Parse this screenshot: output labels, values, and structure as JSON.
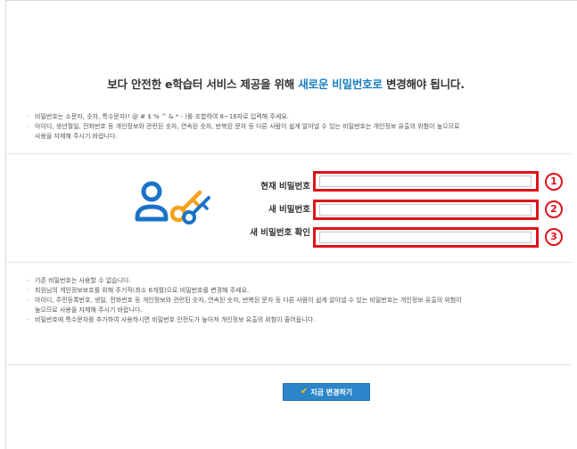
{
  "headline": {
    "prefix": "보다 안전한 e학습터 서비스 제공을 위해 ",
    "highlight": "새로운 비밀번호로",
    "suffix": " 변경해야 됩니다."
  },
  "rules": [
    {
      "line1": "비밀번호는 소문자, 숫자, 특수문자(! @ # $ % ^ & * - )를 조합하여 8~16자로 입력해 주세요.",
      "line2": ""
    },
    {
      "line1": "아이디, 생년월일, 전화번호 등 개인정보와 관련된 숫자, 연속된 숫자, 반복된 문자 등 다른 사람이 쉽게 알아낼 수 있는 비밀번호는 개인정보 유출의 위험이 높으므로",
      "line2": "사용을 자제해 주시기 바랍니다."
    }
  ],
  "form": {
    "current_password_label": "현재 비밀번호",
    "new_password_label": "새 비밀번호",
    "confirm_password_label": "새 비밀번호 확인",
    "current_password_value": "",
    "new_password_value": "",
    "confirm_password_value": ""
  },
  "annotations": {
    "marker_1": "1",
    "marker_2": "2",
    "marker_3": "3",
    "color": "#e0121a"
  },
  "notes": [
    {
      "line1": "기존 비밀번호는 사용할 수 없습니다.",
      "line2": ""
    },
    {
      "line1": "회원님의 개인정보보호를 위해 주기적(최소 6개월)으로 비밀번호를 변경해 주세요.",
      "line2": ""
    },
    {
      "line1": "아이디, 주민등록번호, 생일, 전화번호 등 개인정보와 관련된 숫자, 연속된 숫자, 반복된 문자 등 다른 사람이 쉽게 알아낼 수 있는 비밀번호는 개인정보 유출의 위험이",
      "line2": "높으므로 사용을 자제해 주시기 바랍니다."
    },
    {
      "line1": "비밀번호에 특수문자를 추가하여 사용하시면 비밀번호 안전도가 높아져 개인정보 유출의 위험이 줄어듭니다.",
      "line2": ""
    }
  ],
  "submit": {
    "label": "지금 변경하기",
    "icon": "check-icon"
  },
  "colors": {
    "accent": "#1a7fc1",
    "button": "#2d86c9",
    "logo_blue": "#1a73c7",
    "logo_orange": "#f5a21b"
  }
}
